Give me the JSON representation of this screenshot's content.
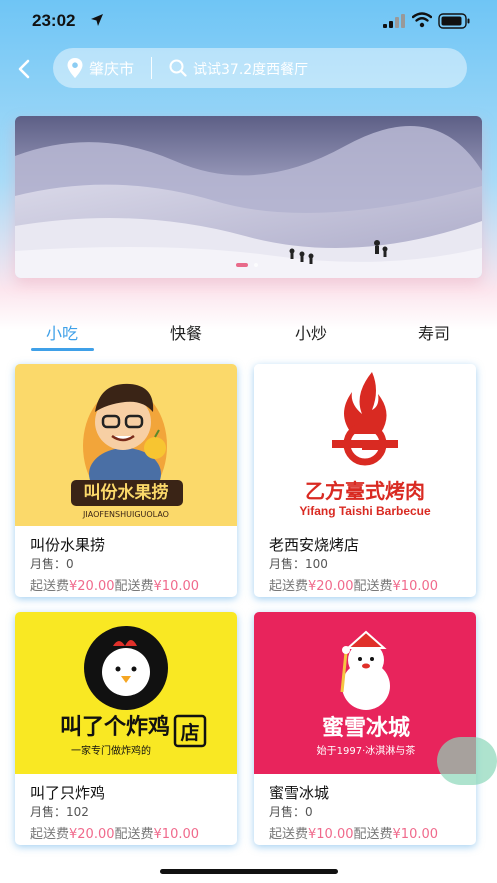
{
  "status_bar": {
    "time": "23:02"
  },
  "header": {
    "city": "肇庆市",
    "search_placeholder": "试试37.2度西餐厅"
  },
  "tabs": [
    {
      "label": "小吃",
      "active": true
    },
    {
      "label": "快餐",
      "active": false
    },
    {
      "label": "小炒",
      "active": false
    },
    {
      "label": "寿司",
      "active": false
    }
  ],
  "shops": [
    {
      "name": "叫份水果捞",
      "sales": "月售：0",
      "min_label": "起送费",
      "min_price": "¥20.00",
      "delivery_label": "配送费",
      "delivery_price": "¥10.00",
      "logo_text": "叫份水果捞",
      "logo_sub": "JIAOFENSHUIGUOLAO",
      "logo_bg": "#fbd96a"
    },
    {
      "name": "老西安烧烤店",
      "sales": "月售：100",
      "min_label": "起送费",
      "min_price": "¥20.00",
      "delivery_label": "配送费",
      "delivery_price": "¥10.00",
      "logo_text": "乙方臺式烤肉",
      "logo_sub": "Yifang Taishi Barbecue",
      "logo_bg": "#ffffff"
    },
    {
      "name": "叫了只炸鸡",
      "sales": "月售：102",
      "min_label": "起送费",
      "min_price": "¥20.00",
      "delivery_label": "配送费",
      "delivery_price": "¥10.00",
      "logo_text": "叫了个炸鸡",
      "logo_badge": "店",
      "logo_sub": "一家专门做炸鸡的",
      "logo_bg": "#f9e823"
    },
    {
      "name": "蜜雪冰城",
      "sales": "月售：0",
      "min_label": "起送费",
      "min_price": "¥10.00",
      "delivery_label": "配送费",
      "delivery_price": "¥10.00",
      "logo_text": "蜜雪冰城",
      "logo_sub": "始于1997·冰淇淋与茶",
      "logo_bg": "#e8245c"
    }
  ],
  "colors": {
    "accent": "#3fa0e8",
    "price": "#f06a8c",
    "header_top": "#6fc5f5"
  }
}
